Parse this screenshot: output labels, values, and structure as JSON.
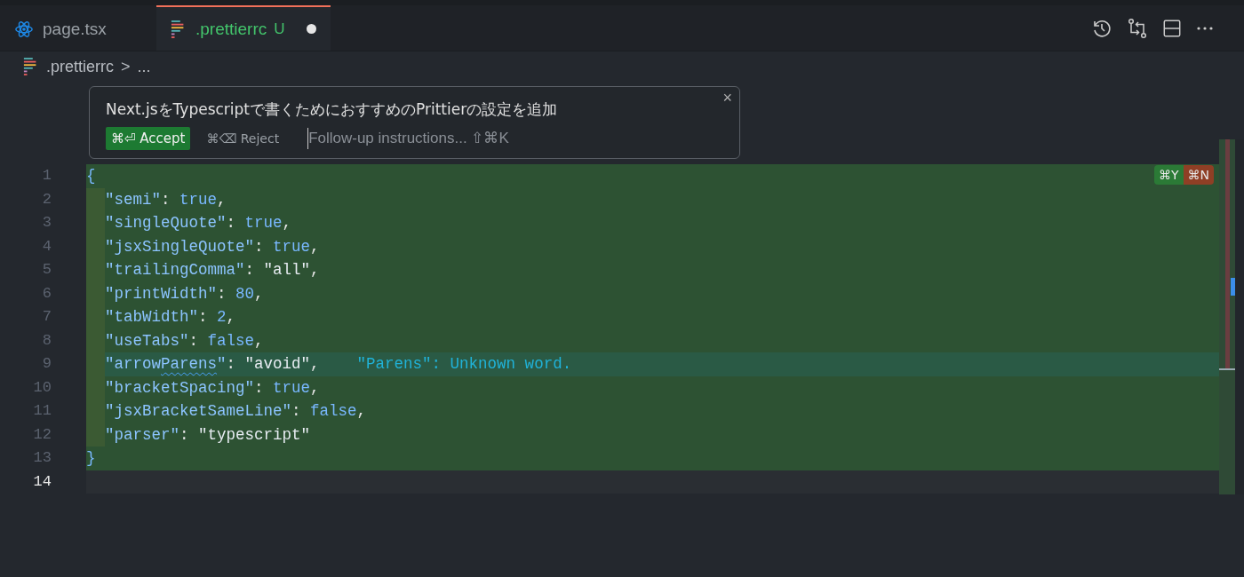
{
  "tabs": [
    {
      "label": "page.tsx",
      "kind": "react",
      "selected": false,
      "modified": false
    },
    {
      "label": ".prettierrc",
      "kind": "prettier",
      "selected": true,
      "modified": true,
      "git_status": "U"
    }
  ],
  "toolbar": [
    {
      "kind": "history"
    },
    {
      "kind": "compare"
    },
    {
      "kind": "split"
    },
    {
      "kind": "more"
    }
  ],
  "breadcrumb": {
    "file": ".prettierrc",
    "separator": ">",
    "rest": "..."
  },
  "inline_prompt": {
    "title": "Next.jsをTypescriptで書くためにおすすめのPrittierの設定を追加",
    "accept": "⌘⏎ Accept",
    "reject": "⌘⌫ Reject",
    "placeholder": "Follow-up instructions... ⇧⌘K",
    "close": "×"
  },
  "diff_actions": {
    "accept": "⌘Y",
    "reject": "⌘N"
  },
  "lines": [
    {
      "number": "1",
      "added": true,
      "highlighted": false,
      "cursor": false,
      "indented": false,
      "tokens": [
        {
          "text": "{",
          "kind": "bracket"
        }
      ]
    },
    {
      "number": "2",
      "added": true,
      "highlighted": false,
      "cursor": false,
      "indented": true,
      "tokens": [
        {
          "text": "\"semi\"",
          "kind": "key"
        },
        {
          "text": ": ",
          "kind": "punct"
        },
        {
          "text": "true",
          "kind": "literal"
        },
        {
          "text": ",",
          "kind": "punct"
        }
      ]
    },
    {
      "number": "3",
      "added": true,
      "highlighted": false,
      "cursor": false,
      "indented": true,
      "tokens": [
        {
          "text": "\"singleQuote\"",
          "kind": "key"
        },
        {
          "text": ": ",
          "kind": "punct"
        },
        {
          "text": "true",
          "kind": "literal"
        },
        {
          "text": ",",
          "kind": "punct"
        }
      ]
    },
    {
      "number": "4",
      "added": true,
      "highlighted": false,
      "cursor": false,
      "indented": true,
      "tokens": [
        {
          "text": "\"jsxSingleQuote\"",
          "kind": "key"
        },
        {
          "text": ": ",
          "kind": "punct"
        },
        {
          "text": "true",
          "kind": "literal"
        },
        {
          "text": ",",
          "kind": "punct"
        }
      ]
    },
    {
      "number": "5",
      "added": true,
      "highlighted": false,
      "cursor": false,
      "indented": true,
      "tokens": [
        {
          "text": "\"trailingComma\"",
          "kind": "key"
        },
        {
          "text": ": ",
          "kind": "punct"
        },
        {
          "text": "\"all\"",
          "kind": "string"
        },
        {
          "text": ",",
          "kind": "punct"
        }
      ]
    },
    {
      "number": "6",
      "added": true,
      "highlighted": false,
      "cursor": false,
      "indented": true,
      "tokens": [
        {
          "text": "\"printWidth\"",
          "kind": "key"
        },
        {
          "text": ": ",
          "kind": "punct"
        },
        {
          "text": "80",
          "kind": "literal"
        },
        {
          "text": ",",
          "kind": "punct"
        }
      ]
    },
    {
      "number": "7",
      "added": true,
      "highlighted": false,
      "cursor": false,
      "indented": true,
      "tokens": [
        {
          "text": "\"tabWidth\"",
          "kind": "key"
        },
        {
          "text": ": ",
          "kind": "punct"
        },
        {
          "text": "2",
          "kind": "literal"
        },
        {
          "text": ",",
          "kind": "punct"
        }
      ]
    },
    {
      "number": "8",
      "added": true,
      "highlighted": false,
      "cursor": false,
      "indented": true,
      "tokens": [
        {
          "text": "\"useTabs\"",
          "kind": "key"
        },
        {
          "text": ": ",
          "kind": "punct"
        },
        {
          "text": "false",
          "kind": "literal"
        },
        {
          "text": ",",
          "kind": "punct"
        }
      ]
    },
    {
      "number": "9",
      "added": true,
      "highlighted": true,
      "cursor": false,
      "indented": true,
      "tokens": [
        {
          "text": "\"arrow",
          "kind": "key"
        },
        {
          "text": "Parens",
          "kind": "misspelled"
        },
        {
          "text": "\"",
          "kind": "key"
        },
        {
          "text": ": ",
          "kind": "punct"
        },
        {
          "text": "\"avoid\"",
          "kind": "string"
        },
        {
          "text": ",",
          "kind": "punct"
        }
      ],
      "diagnostic": "\"Parens\": Unknown word."
    },
    {
      "number": "10",
      "added": true,
      "highlighted": false,
      "cursor": false,
      "indented": true,
      "tokens": [
        {
          "text": "\"bracketSpacing\"",
          "kind": "key"
        },
        {
          "text": ": ",
          "kind": "punct"
        },
        {
          "text": "true",
          "kind": "literal"
        },
        {
          "text": ",",
          "kind": "punct"
        }
      ]
    },
    {
      "number": "11",
      "added": true,
      "highlighted": false,
      "cursor": false,
      "indented": true,
      "tokens": [
        {
          "text": "\"jsxBracketSameLine\"",
          "kind": "key"
        },
        {
          "text": ": ",
          "kind": "punct"
        },
        {
          "text": "false",
          "kind": "literal"
        },
        {
          "text": ",",
          "kind": "punct"
        }
      ]
    },
    {
      "number": "12",
      "added": true,
      "highlighted": false,
      "cursor": false,
      "indented": true,
      "tokens": [
        {
          "text": "\"parser\"",
          "kind": "key"
        },
        {
          "text": ": ",
          "kind": "punct"
        },
        {
          "text": "\"typescript\"",
          "kind": "string"
        }
      ]
    },
    {
      "number": "13",
      "added": true,
      "highlighted": false,
      "cursor": false,
      "indented": false,
      "tokens": [
        {
          "text": "}",
          "kind": "bracket"
        }
      ]
    },
    {
      "number": "14",
      "added": false,
      "highlighted": false,
      "cursor": true,
      "indented": false
    }
  ]
}
